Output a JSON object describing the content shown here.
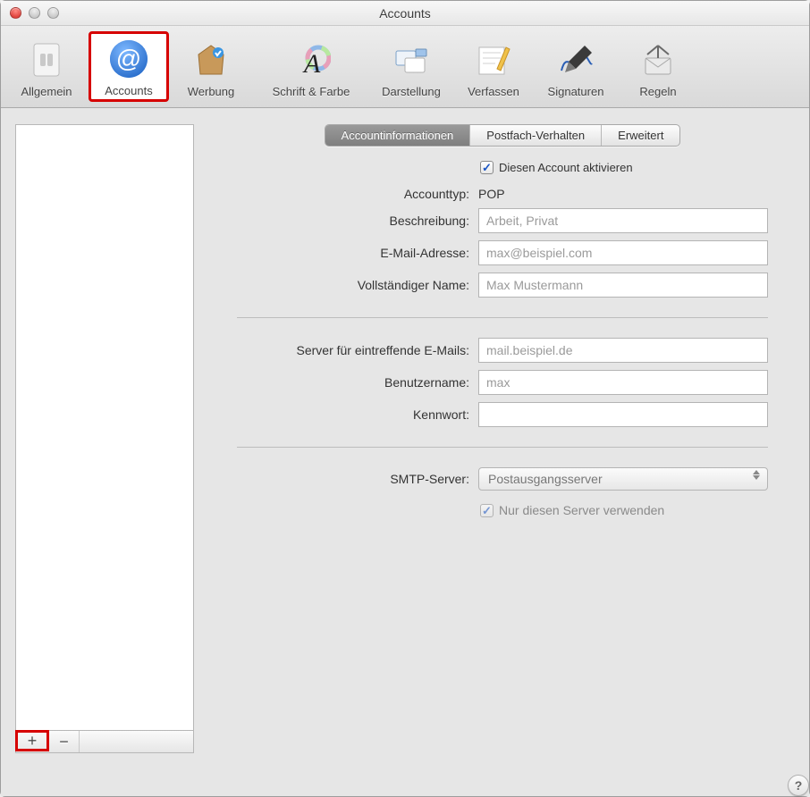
{
  "window": {
    "title": "Accounts"
  },
  "toolbar": {
    "items": [
      {
        "label": "Allgemein"
      },
      {
        "label": "Accounts"
      },
      {
        "label": "Werbung"
      },
      {
        "label": "Schrift & Farbe"
      },
      {
        "label": "Darstellung"
      },
      {
        "label": "Verfassen"
      },
      {
        "label": "Signaturen"
      },
      {
        "label": "Regeln"
      }
    ]
  },
  "tabs": {
    "info": "Accountinformationen",
    "mailbox": "Postfach-Verhalten",
    "advanced": "Erweitert"
  },
  "form": {
    "activate_label": "Diesen Account aktivieren",
    "type_label": "Accounttyp:",
    "type_value": "POP",
    "description_label": "Beschreibung:",
    "description_placeholder": "Arbeit, Privat",
    "email_label": "E-Mail-Adresse:",
    "email_placeholder": "max@beispiel.com",
    "fullname_label": "Vollständiger Name:",
    "fullname_placeholder": "Max Mustermann",
    "incoming_label": "Server für eintreffende E-Mails:",
    "incoming_placeholder": "mail.beispiel.de",
    "username_label": "Benutzername:",
    "username_placeholder": "max",
    "password_label": "Kennwort:",
    "smtp_label": "SMTP-Server:",
    "smtp_value": "Postausgangsserver",
    "only_this_server_label": "Nur diesen Server verwenden"
  },
  "list_buttons": {
    "add": "+",
    "remove": "−"
  },
  "help": {
    "label": "?"
  }
}
